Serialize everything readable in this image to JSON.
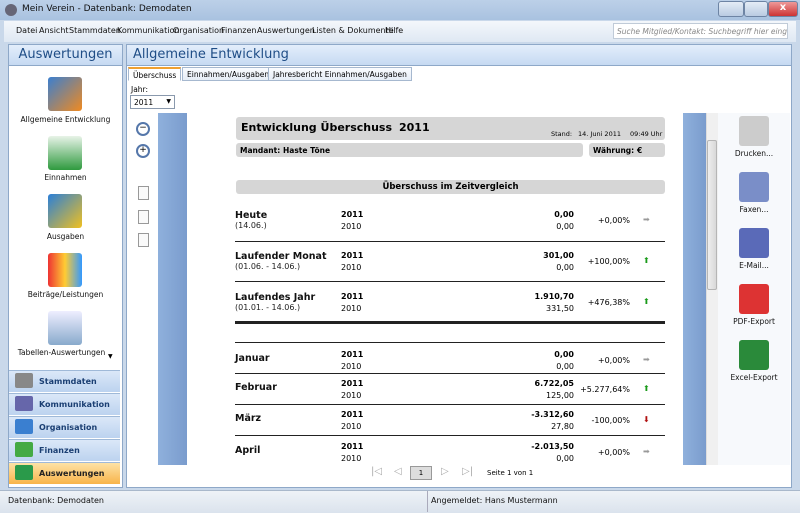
{
  "window": {
    "title": "Mein Verein - Datenbank: Demodaten"
  },
  "menu": [
    "Datei",
    "Ansicht",
    "Stammdaten",
    "Kommunikation",
    "Organisation",
    "Finanzen",
    "Auswertungen",
    "Listen & Dokumente",
    "Hilfe"
  ],
  "search": {
    "placeholder": "Suche Mitglied/Kontakt: Suchbegriff hier eingeben"
  },
  "sidebar": {
    "title": "Auswertungen",
    "items": [
      {
        "label": "Allgemeine Entwicklung"
      },
      {
        "label": "Einnahmen"
      },
      {
        "label": "Ausgaben"
      },
      {
        "label": "Beiträge/Leistungen"
      },
      {
        "label": "Tabellen-Auswertungen"
      }
    ],
    "nav": [
      {
        "label": "Stammdaten"
      },
      {
        "label": "Kommunikation"
      },
      {
        "label": "Organisation"
      },
      {
        "label": "Finanzen"
      },
      {
        "label": "Auswertungen",
        "active": true
      }
    ]
  },
  "main": {
    "title": "Allgemeine Entwicklung",
    "tabs": [
      {
        "label": "Überschuss",
        "active": true
      },
      {
        "label": "Einnahmen/Ausgaben"
      },
      {
        "label": "Jahresbericht Einnahmen/Ausgaben"
      }
    ],
    "year_label": "Jahr:",
    "year_value": "2011"
  },
  "report": {
    "title": "Entwicklung Überschuss",
    "year": "2011",
    "stand_label": "Stand:",
    "stand_date": "14. Juni 2011",
    "stand_time": "09:49 Uhr",
    "mandant_label": "Mandant:",
    "mandant": "Haste Töne",
    "currency_label": "Währung:",
    "currency": "€",
    "section": "Überschuss im Zeitvergleich",
    "rows": [
      {
        "label": "Heute",
        "sub": "(14.06.)",
        "y1": "2011",
        "y2": "2010",
        "v1": "0,00",
        "v2": "0,00",
        "pct": "+0,00%",
        "trend": "neutral"
      },
      {
        "label": "Laufender Monat",
        "sub": "(01.06. - 14.06.)",
        "y1": "2011",
        "y2": "2010",
        "v1": "301,00",
        "v2": "0,00",
        "pct": "+100,00%",
        "trend": "up"
      },
      {
        "label": "Laufendes Jahr",
        "sub": "(01.01. - 14.06.)",
        "y1": "2011",
        "y2": "2010",
        "v1": "1.910,70",
        "v2": "331,50",
        "pct": "+476,38%",
        "trend": "up"
      },
      {
        "label": "Januar",
        "y1": "2011",
        "y2": "2010",
        "v1": "0,00",
        "v2": "0,00",
        "pct": "+0,00%",
        "trend": "neutral"
      },
      {
        "label": "Februar",
        "y1": "2011",
        "y2": "2010",
        "v1": "6.722,05",
        "v2": "125,00",
        "pct": "+5.277,64%",
        "trend": "up"
      },
      {
        "label": "März",
        "y1": "2011",
        "y2": "2010",
        "v1": "-3.312,60",
        "v2": "27,80",
        "pct": "-100,00%",
        "trend": "down"
      },
      {
        "label": "April",
        "y1": "2011",
        "y2": "2010",
        "v1": "-2.013,50",
        "v2": "0,00",
        "pct": "+0,00%",
        "trend": "neutral"
      }
    ],
    "pager": {
      "page": "1",
      "text": "Seite 1 von 1"
    }
  },
  "tools": [
    {
      "label": "Drucken...",
      "icon": "printer-icon"
    },
    {
      "label": "Faxen...",
      "icon": "fax-icon"
    },
    {
      "label": "E-Mail...",
      "icon": "email-icon"
    },
    {
      "label": "PDF-Export",
      "icon": "pdf-icon"
    },
    {
      "label": "Excel-Export",
      "icon": "excel-icon"
    }
  ],
  "status": {
    "db": "Datenbank: Demodaten",
    "user": "Angemeldet: Hans Mustermann"
  },
  "colors": {
    "up": "#1a9a1a",
    "down": "#b01010",
    "neutral": "#999999",
    "active_nav": "#f8b44a"
  }
}
